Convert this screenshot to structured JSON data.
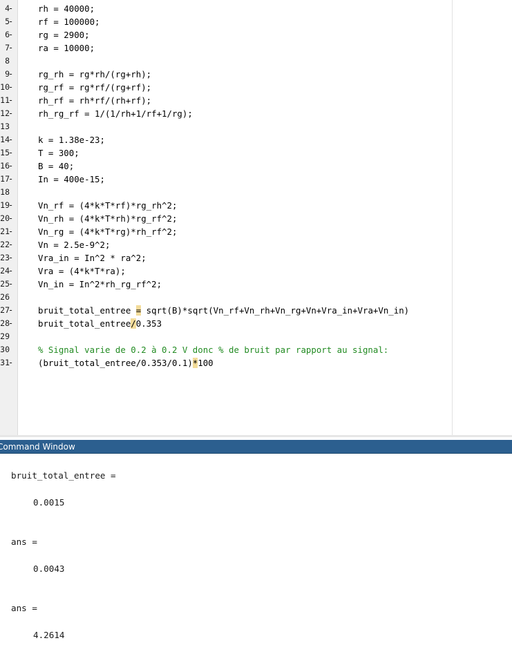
{
  "editor": {
    "lines": [
      {
        "num": "4",
        "marker": "-",
        "code": "rh = 40000;"
      },
      {
        "num": "5",
        "marker": "-",
        "code": "rf = 100000;"
      },
      {
        "num": "6",
        "marker": "-",
        "code": "rg = 2900;"
      },
      {
        "num": "7",
        "marker": "-",
        "code": "ra = 10000;"
      },
      {
        "num": "8",
        "marker": "",
        "code": ""
      },
      {
        "num": "9",
        "marker": "-",
        "code": "rg_rh = rg*rh/(rg+rh);"
      },
      {
        "num": "10",
        "marker": "-",
        "code": "rg_rf = rg*rf/(rg+rf);"
      },
      {
        "num": "11",
        "marker": "-",
        "code": "rh_rf = rh*rf/(rh+rf);"
      },
      {
        "num": "12",
        "marker": "-",
        "code": "rh_rg_rf = 1/(1/rh+1/rf+1/rg);"
      },
      {
        "num": "13",
        "marker": "",
        "code": ""
      },
      {
        "num": "14",
        "marker": "-",
        "code": "k = 1.38e-23;"
      },
      {
        "num": "15",
        "marker": "-",
        "code": "T = 300;"
      },
      {
        "num": "16",
        "marker": "-",
        "code": "B = 40;"
      },
      {
        "num": "17",
        "marker": "-",
        "code": "In = 400e-15;"
      },
      {
        "num": "18",
        "marker": "",
        "code": ""
      },
      {
        "num": "19",
        "marker": "-",
        "code": "Vn_rf = (4*k*T*rf)*rg_rh^2;"
      },
      {
        "num": "20",
        "marker": "-",
        "code": "Vn_rh = (4*k*T*rh)*rg_rf^2;"
      },
      {
        "num": "21",
        "marker": "-",
        "code": "Vn_rg = (4*k*T*rg)*rh_rf^2;"
      },
      {
        "num": "22",
        "marker": "-",
        "code": "Vn = 2.5e-9^2;"
      },
      {
        "num": "23",
        "marker": "-",
        "code": "Vra_in = In^2 * ra^2;"
      },
      {
        "num": "24",
        "marker": "-",
        "code": "Vra = (4*k*T*ra);"
      },
      {
        "num": "25",
        "marker": "-",
        "code": "Vn_in = In^2*rh_rg_rf^2;"
      },
      {
        "num": "26",
        "marker": "",
        "code": ""
      },
      {
        "num": "27",
        "marker": "-",
        "code_pre": "bruit_total_entree ",
        "code_hl": "=",
        "code_post": " sqrt(B)*sqrt(Vn_rf+Vn_rh+Vn_rg+Vn+Vra_in+Vra+Vn_in)"
      },
      {
        "num": "28",
        "marker": "-",
        "code_pre": "bruit_total_entree",
        "code_hl": "/",
        "code_post": "0.353"
      },
      {
        "num": "29",
        "marker": "",
        "code": ""
      },
      {
        "num": "30",
        "marker": "",
        "code": "% Signal varie de 0.2 à 0.2 V donc % de bruit par rapport au signal:",
        "comment": true
      },
      {
        "num": "31",
        "marker": "-",
        "code_pre": "(bruit_total_entree/0.353/0.1)",
        "code_hl": "*",
        "code_post": "100"
      }
    ]
  },
  "command_window": {
    "title": "Command Window",
    "outputs": [
      {
        "name": "bruit_total_entree =",
        "value": "0.0015"
      },
      {
        "name": "ans =",
        "value": "0.0043"
      },
      {
        "name": "ans =",
        "value": "4.2614"
      }
    ]
  }
}
